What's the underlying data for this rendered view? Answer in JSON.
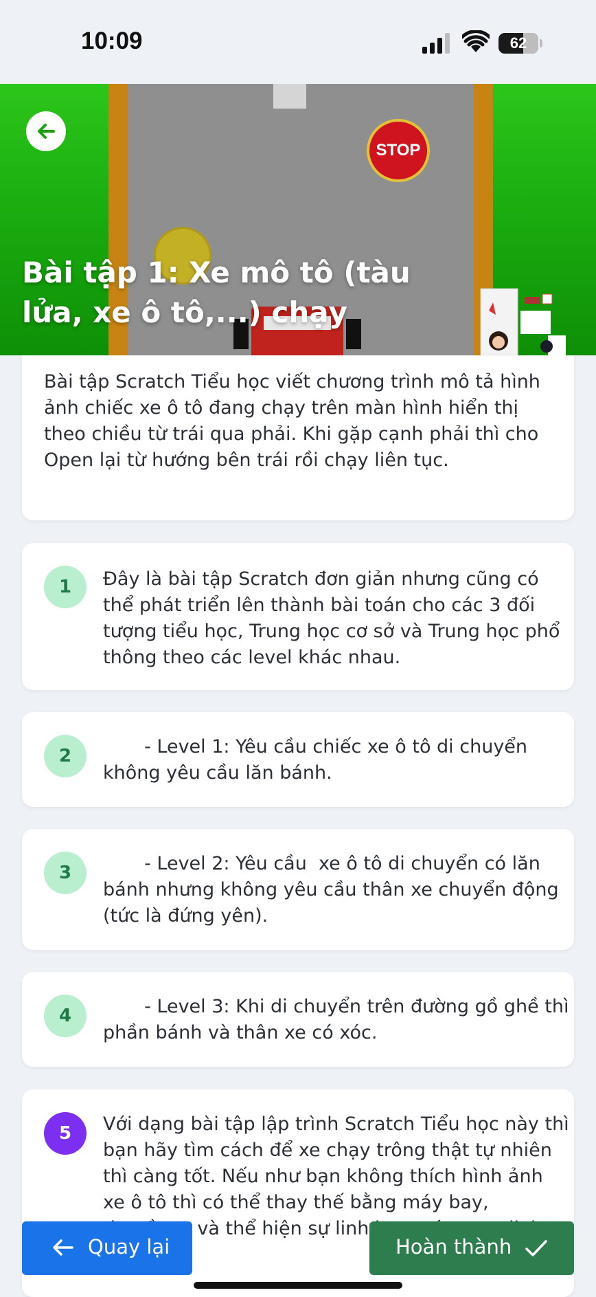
{
  "status_bar": {
    "time": "10:09",
    "battery": "62",
    "battery_level": 0.62
  },
  "hero": {
    "title": "Bài tập 1: Xe mô tô (tàu lửa, xe ô tô,...) chạy",
    "stop_sign_text": "STOP"
  },
  "intro": {
    "text": "Bài tập Scratch Tiểu học viết chương trình mô tả hình ảnh chiếc xe ô tô đang chạy trên màn hình hiển thị theo chiều từ trái qua phải. Khi gặp cạnh phải thì cho Open lại từ hướng bên trái rồi chạy liên tục."
  },
  "steps": [
    {
      "number": "1",
      "text": "Đây là bài tập Scratch đơn giản nhưng cũng có thể phát triển lên thành bài toán cho các 3 đối tượng tiểu học, Trung học cơ sở và Trung học phổ thông theo các level khác nhau."
    },
    {
      "number": "2",
      "text": "       - Level 1: Yêu cầu chiếc xe ô tô di chuyển không yêu cầu lăn bánh."
    },
    {
      "number": "3",
      "text": "       - Level 2: Yêu cầu  xe ô tô di chuyển có lăn bánh nhưng không yêu cầu thân xe chuyển động (tức là đứng yên)."
    },
    {
      "number": "4",
      "text": "       - Level 3: Khi di chuyển trên đường gồ ghề thì phần bánh và thân xe có xóc."
    },
    {
      "number": "5",
      "text": "Với dạng bài tập lập trình Scratch Tiểu học này thì bạn hãy tìm cách để xe chạy trông thật tự nhiên thì càng tốt. Nếu như bạn không thích hình ảnh xe ô tô thì có thể thay thế bằng máy bay, thuyền,... và thể hiện sự linh hoạt sáng tạo linh hoạt của"
    }
  ],
  "footer": {
    "back_label": "Quay lại",
    "done_label": "Hoàn thành"
  },
  "colors": {
    "primary_blue": "#1a73e8",
    "done_green": "#2e7d4f",
    "active_step": "#7c2ff0",
    "step_badge": "#b9efcf"
  }
}
